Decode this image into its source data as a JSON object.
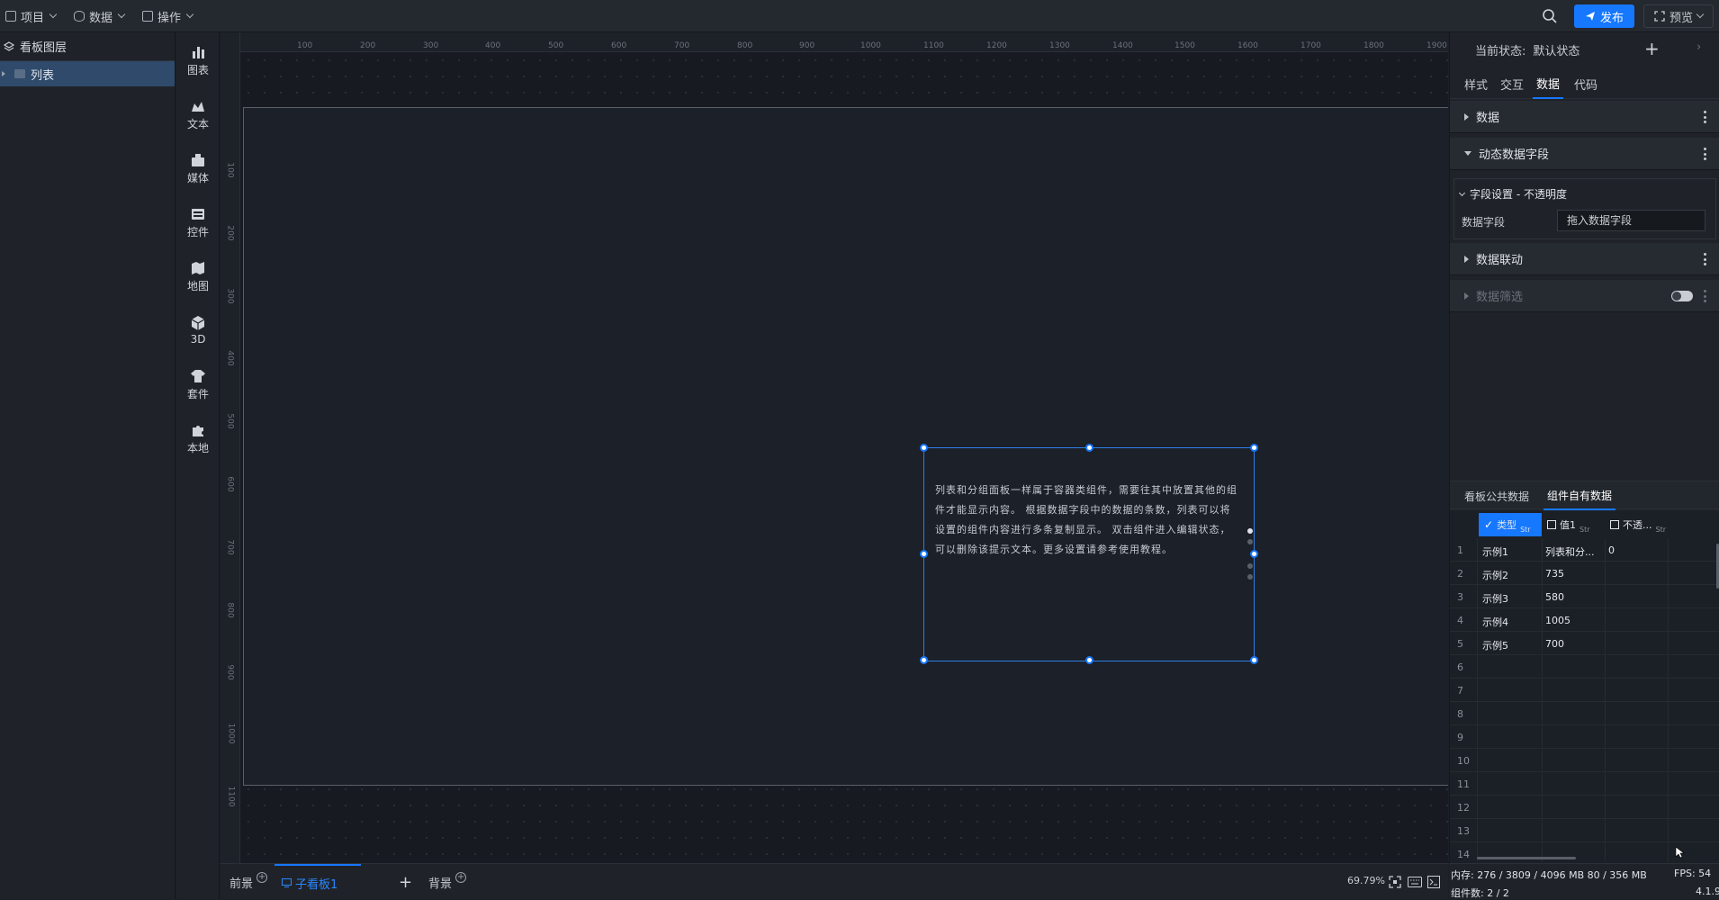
{
  "topbar": {
    "menus": [
      {
        "label": "项目",
        "icon": "file-icon"
      },
      {
        "label": "数据",
        "icon": "database-icon"
      },
      {
        "label": "操作",
        "icon": "grid-icon"
      }
    ],
    "publish_label": "发布",
    "preview_label": "预览",
    "accent": "#1677ff"
  },
  "layers": {
    "title": "看板图层",
    "items": [
      {
        "label": "列表"
      }
    ]
  },
  "toolbar": {
    "items": [
      {
        "label": "图表",
        "icon": "bar-chart-icon"
      },
      {
        "label": "文本",
        "icon": "text-icon"
      },
      {
        "label": "媒体",
        "icon": "media-icon"
      },
      {
        "label": "控件",
        "icon": "control-icon"
      },
      {
        "label": "地图",
        "icon": "map-icon"
      },
      {
        "label": "3D",
        "icon": "cube-icon"
      },
      {
        "label": "套件",
        "icon": "shirt-icon"
      },
      {
        "label": "本地",
        "icon": "puzzle-icon"
      }
    ]
  },
  "ruler": {
    "top": [
      "100",
      "200",
      "300",
      "400",
      "500",
      "600",
      "700",
      "800",
      "900",
      "1000",
      "1100",
      "1200",
      "1300",
      "1400",
      "1500",
      "1600",
      "1700",
      "1800",
      "1900"
    ],
    "left": [
      "100",
      "200",
      "300",
      "400",
      "500",
      "600",
      "700",
      "800",
      "900",
      "1000",
      "1100"
    ]
  },
  "canvas": {
    "list_text": "列表和分组面板一样属于容器类组件，需要往其中放置其他的组件才能显示内容。 根据数据字段中的数据的条数，列表可以将设置的组件内容进行多条复制显示。 双击组件进入编辑状态，可以删除该提示文本。更多设置请参考使用教程。"
  },
  "bottom": {
    "tabs": [
      {
        "label": "前景"
      },
      {
        "label": "子看板1"
      },
      {
        "label": "背景"
      }
    ],
    "zoom": "69.79%"
  },
  "right": {
    "state_label": "当前状态:",
    "state_value": "默认状态",
    "tabs": [
      "样式",
      "交互",
      "数据",
      "代码"
    ],
    "active_tab": "数据",
    "sections": {
      "data": "数据",
      "dynamic": "动态数据字段",
      "field_setting": "字段设置 - 不透明度",
      "field_label": "数据字段",
      "field_placeholder": "拖入数据字段",
      "linkage": "数据联动",
      "filter": "数据筛选"
    },
    "data_tabs": [
      "看板公共数据",
      "组件自有数据"
    ],
    "grid_headers": [
      {
        "label": "类型",
        "type": "Str",
        "checked": true
      },
      {
        "label": "值1",
        "type": "Str",
        "checked": false
      },
      {
        "label": "不透...",
        "type": "Str",
        "checked": false
      }
    ],
    "rows": [
      {
        "n": "1",
        "type": "示例1",
        "value": "列表和分...",
        "opacity": "0"
      },
      {
        "n": "2",
        "type": "示例2",
        "value": "735",
        "opacity": ""
      },
      {
        "n": "3",
        "type": "示例3",
        "value": "580",
        "opacity": ""
      },
      {
        "n": "4",
        "type": "示例4",
        "value": "1005",
        "opacity": ""
      },
      {
        "n": "5",
        "type": "示例5",
        "value": "700",
        "opacity": ""
      },
      {
        "n": "6",
        "type": "",
        "value": "",
        "opacity": ""
      },
      {
        "n": "7",
        "type": "",
        "value": "",
        "opacity": ""
      },
      {
        "n": "8",
        "type": "",
        "value": "",
        "opacity": ""
      },
      {
        "n": "9",
        "type": "",
        "value": "",
        "opacity": ""
      },
      {
        "n": "10",
        "type": "",
        "value": "",
        "opacity": ""
      },
      {
        "n": "11",
        "type": "",
        "value": "",
        "opacity": ""
      },
      {
        "n": "12",
        "type": "",
        "value": "",
        "opacity": ""
      },
      {
        "n": "13",
        "type": "",
        "value": "",
        "opacity": ""
      },
      {
        "n": "14",
        "type": "",
        "value": "",
        "opacity": ""
      }
    ]
  },
  "status": {
    "memory": "内存: 276 / 3809 / 4096 MB  80 / 356 MB",
    "fps": "FPS: 54",
    "components": "组件数: 2 / 2",
    "version": "4.1.9"
  }
}
